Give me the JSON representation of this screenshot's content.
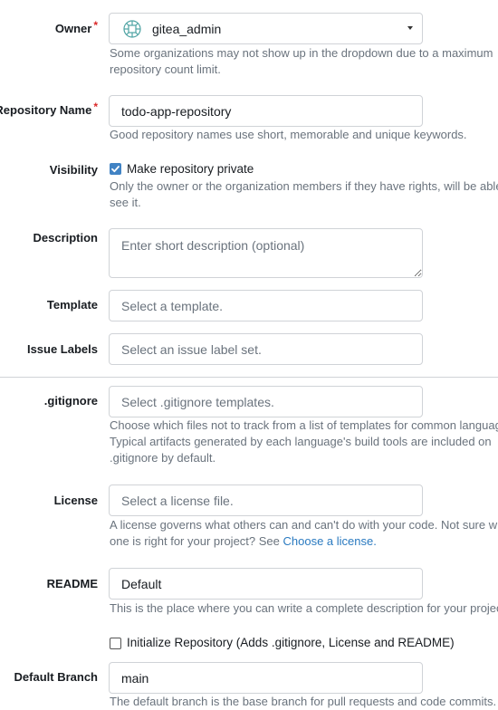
{
  "owner": {
    "label": "Owner",
    "required_mark": "*",
    "value": "gitea_admin",
    "avatar_icon": "gitea-org-avatar-icon",
    "help": [
      "Some organizations may not show up in the dropdown due to a maximum",
      "repository count limit."
    ]
  },
  "repo_name": {
    "label": "Repository Name",
    "required_mark": "*",
    "value": "todo-app-repository",
    "help": "Good repository names use short, memorable and unique keywords."
  },
  "visibility": {
    "label": "Visibility",
    "checkbox_label": "Make repository private",
    "checked": true,
    "help": [
      "Only the owner or the organization members if they have rights, will be able to",
      "see it."
    ]
  },
  "description": {
    "label": "Description",
    "placeholder": "Enter short description (optional)"
  },
  "template": {
    "label": "Template",
    "placeholder": "Select a template."
  },
  "issue_labels": {
    "label": "Issue Labels",
    "placeholder": "Select an issue label set."
  },
  "gitignore": {
    "label": ".gitignore",
    "placeholder": "Select .gitignore templates.",
    "help": [
      "Choose which files not to track from a list of templates for common languages.",
      "Typical artifacts generated by each language's build tools are included on",
      ".gitignore by default."
    ]
  },
  "license": {
    "label": "License",
    "placeholder": "Select a license file.",
    "help_line1": "A license governs what others can and can't do with your code. Not sure which",
    "help_line2_prefix": "one is right for your project? See ",
    "help_link": "Choose a license.",
    "help_line2_suffix": ""
  },
  "readme": {
    "label": "README",
    "value": "Default",
    "help": "This is the place where you can write a complete description for your project."
  },
  "init_repo": {
    "checkbox_label": "Initialize Repository (Adds .gitignore, License and README)",
    "checked": false
  },
  "default_branch": {
    "label": "Default Branch",
    "value": "main",
    "help": "The default branch is the base branch for pull requests and code commits."
  },
  "colors": {
    "accent": "#4183c4",
    "link": "#2a7ac0",
    "required": "#db2828",
    "help_text": "#6a737d"
  }
}
